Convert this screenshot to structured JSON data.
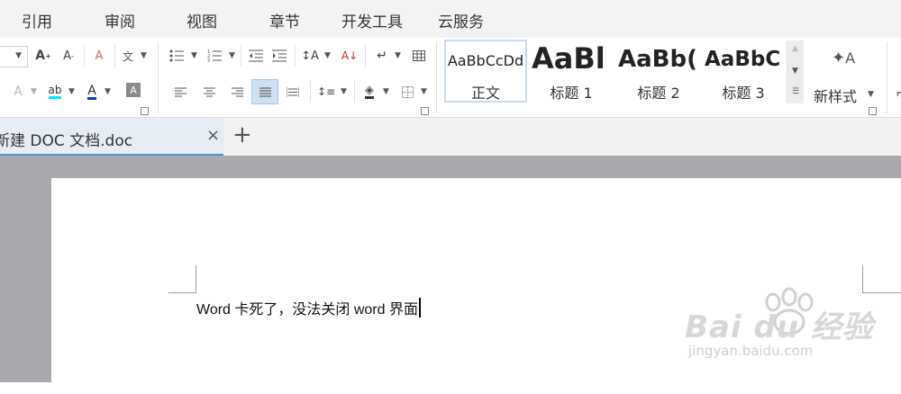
{
  "menu": {
    "items": [
      "引用",
      "审阅",
      "视图",
      "章节",
      "开发工具",
      "云服务"
    ]
  },
  "ribbon": {
    "font_group_row1": {
      "font_size_value": "",
      "grow_font": "A⁺",
      "shrink_font": "A⁻",
      "clear_format": "✎",
      "phonetic": "变"
    },
    "font_group_row2": {
      "text_effect": "A",
      "highlight": "ab",
      "font_color": "A",
      "char_shading": "A"
    },
    "styles": [
      {
        "sample": "AaBbCcDd",
        "name": "正文"
      },
      {
        "sample": "AaBl",
        "name": "标题 1"
      },
      {
        "sample": "AaBb(",
        "name": "标题 2"
      },
      {
        "sample": "AaBbC",
        "name": "标题 3"
      }
    ],
    "new_style_label": "新样式"
  },
  "tabs": {
    "document_title": "新建 DOC 文档.doc",
    "close_symbol": "×",
    "new_tab_symbol": "+"
  },
  "document": {
    "text": "Word 卡死了，没法关闭 word 界面"
  },
  "watermark": {
    "brand": "Bai du 经验",
    "url": "jingyan.baidu.com"
  },
  "colors": {
    "highlight_cyan": "#00e5ff",
    "font_color_blue": "#1034d6",
    "active_tab_border": "#5b8ed4",
    "canvas_gray": "#a8a9ad"
  },
  "icons": [
    "increase-font-icon",
    "decrease-font-icon",
    "clear-format-icon",
    "phonetic-guide-icon",
    "bullets-icon",
    "numbering-icon",
    "decrease-indent-icon",
    "increase-indent-icon",
    "text-direction-icon",
    "sort-icon",
    "show-marks-icon",
    "table-icon",
    "align-left-icon",
    "align-center-icon",
    "align-right-icon",
    "justify-icon",
    "distributed-icon",
    "line-spacing-icon",
    "shading-icon",
    "borders-icon",
    "new-style-icon"
  ]
}
